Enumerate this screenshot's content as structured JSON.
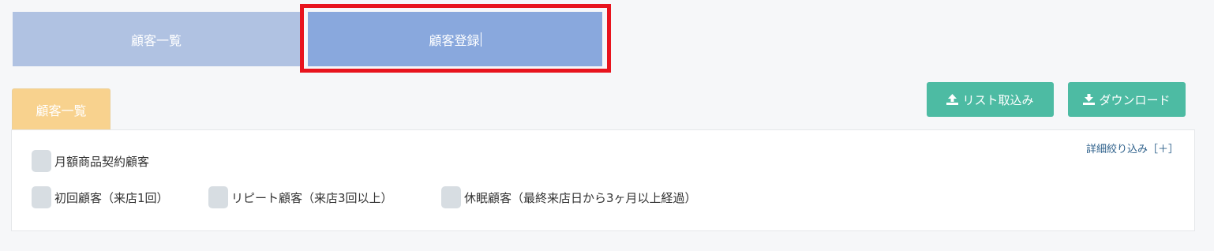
{
  "tabs": {
    "list_label": "顧客一覧",
    "register_label": "顧客登録"
  },
  "section": {
    "tab_label": "顧客一覧"
  },
  "actions": {
    "import_label": "リスト取込み",
    "download_label": "ダウンロード"
  },
  "filters": {
    "detail_link": "詳細絞り込み［＋］",
    "monthly": "月額商品契約顧客",
    "first_visit": "初回顧客（来店1回）",
    "repeat": "リピート顧客（来店3回以上）",
    "dormant": "休眠顧客（最終来店日から3ヶ月以上経過）"
  },
  "colors": {
    "highlight": "#e8141e",
    "tab_active": "#89a8dd",
    "tab_inactive": "#b0c2e2",
    "section_tab": "#f8d28e",
    "action_button": "#4dbba3"
  },
  "icons": {
    "import": "upload-icon",
    "download": "download-icon"
  }
}
